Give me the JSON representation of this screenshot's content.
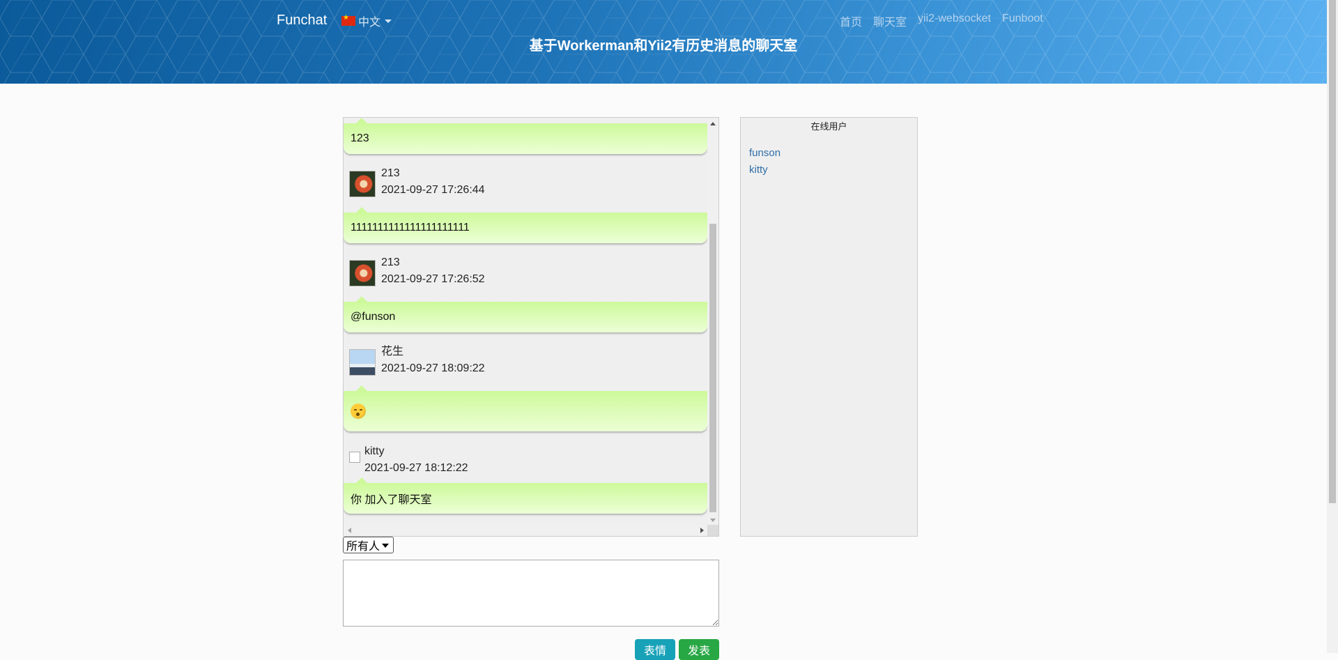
{
  "header": {
    "brand": "Funchat",
    "language": "中文",
    "nav": [
      "首页",
      "聊天室",
      "yii2-websocket",
      "Funboot"
    ],
    "subtitle": "基于Workerman和Yii2有历史消息的聊天室"
  },
  "messages": [
    {
      "text": "123"
    },
    {
      "user": "213",
      "time": "2021-09-27 17:26:44",
      "text": "1111111111111111111111"
    },
    {
      "user": "213",
      "time": "2021-09-27 17:26:52",
      "text": "@funson"
    },
    {
      "user": "花生",
      "time": "2021-09-27 18:09:22",
      "text": ""
    },
    {
      "user": "kitty",
      "time": "2021-09-27 18:12:22",
      "text": "你 加入了聊天室"
    }
  ],
  "online": {
    "title": "在线用户",
    "users": [
      "funson",
      "kitty"
    ]
  },
  "composer": {
    "recipient": "所有人",
    "emoji_label": "表情",
    "send_label": "发表"
  },
  "colors": {
    "header_start": "#0b5a9a",
    "header_end": "#5ab0f0",
    "bubble": "#cdf99a",
    "emoji_button": "#17a2b8",
    "send_button": "#28a745",
    "user_link": "#2f6ea8"
  }
}
